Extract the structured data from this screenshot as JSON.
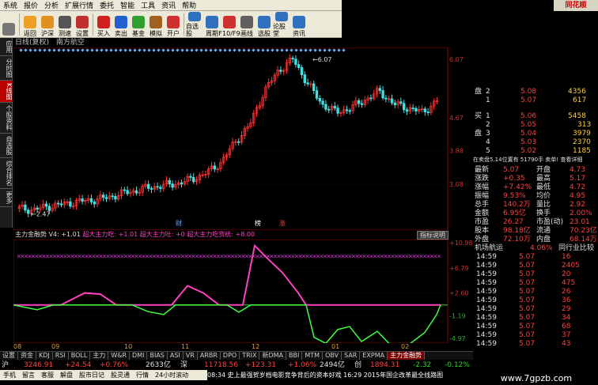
{
  "menu": [
    "系统",
    "报价",
    "分析",
    "扩展行情",
    "委托",
    "智能",
    "工具",
    "资讯",
    "帮助"
  ],
  "brand": "同花顺",
  "toolbar": [
    {
      "label": "",
      "icon": "grid-icon",
      "color": "#777"
    },
    {
      "label": "返回",
      "icon": "back-arrow-icon",
      "color": "#f0a020"
    },
    {
      "label": "沪深",
      "icon": "face-icon",
      "color": "#e09020"
    },
    {
      "label": "测速",
      "icon": "clock-icon",
      "color": "#555"
    },
    {
      "label": "设置",
      "icon": "close-icon",
      "color": "#c03030"
    },
    {
      "label": "买入",
      "icon": "buy-icon",
      "color": "#d02020"
    },
    {
      "label": "卖出",
      "icon": "sell-icon",
      "color": "#2060d0"
    },
    {
      "label": "基金",
      "icon": "fund-icon",
      "color": "#30a030"
    },
    {
      "label": "模拟",
      "icon": "hammer-icon",
      "color": "#a06020"
    },
    {
      "label": "开户",
      "icon": "book-icon",
      "color": "#d03030"
    },
    {
      "label": "自选股",
      "icon": "star-icon",
      "color": "#3070c0"
    },
    {
      "label": "周期",
      "icon": "period-icon",
      "color": "#3070c0"
    },
    {
      "label": "F10/F9",
      "icon": "f10-icon",
      "color": "#d03030"
    },
    {
      "label": "画线",
      "icon": "pen-icon",
      "color": "#606060"
    },
    {
      "label": "选股",
      "icon": "select-icon",
      "color": "#3070c0"
    },
    {
      "label": "论股堂",
      "icon": "forum-icon",
      "color": "#3070c0"
    },
    {
      "label": "资讯",
      "icon": "news-icon",
      "color": "#3070c0"
    }
  ],
  "sidetabs": [
    "应用",
    "分时图",
    "K线图",
    "个股资料",
    "自选股",
    "综合排名",
    "更多"
  ],
  "active_sidetab": 2,
  "chart_title": [
    "日线(复权)",
    "南方航空"
  ],
  "price_axis": [
    "6.07",
    "4.67",
    "3.88",
    "3.08"
  ],
  "peak_label": "6.07",
  "low_label": "2.47",
  "event_markers": [
    "财",
    "榜",
    "涨"
  ],
  "indicator": {
    "name": "主力金融势",
    "v4": "V4: +1.01",
    "a": "超大主力吃: +1.01",
    "b": "超大主力吐: +0",
    "c": "超大主力吃货统: +8.00",
    "help": "指标说明",
    "axis": [
      "+10.98",
      "+6.79",
      "+2.60",
      "-1.19",
      "-4.97"
    ]
  },
  "dates": [
    "08",
    "09",
    "10",
    "11",
    "12",
    "01",
    "02"
  ],
  "bottom_tabs": [
    "设置",
    "资金",
    "KDJ",
    "RSI",
    "BOLL",
    "主力",
    "W&R",
    "DMI",
    "BIAS",
    "ASI",
    "VR",
    "ARBR",
    "DPO",
    "TRIX",
    "新DMA",
    "BBI",
    "MTM",
    "OBV",
    "SAR",
    "EXPMA",
    "主力金融势"
  ],
  "active_bottom_tab": "主力金融势",
  "orderbook": {
    "sell_label": "盘",
    "buy_label": "买",
    "pan_label": "盘",
    "sells": [
      [
        "2",
        "5.08",
        "4356"
      ],
      [
        "1",
        "5.07",
        "617"
      ]
    ],
    "buys": [
      [
        "1",
        "5.06",
        "5458"
      ],
      [
        "2",
        "5.05",
        "313"
      ],
      [
        "3",
        "5.04",
        "3979"
      ],
      [
        "4",
        "5.03",
        "2370"
      ],
      [
        "5",
        "5.02",
        "1185"
      ]
    ]
  },
  "note": "在卖盘5.14位置有    51790手 卖单! 查看详细",
  "stats": [
    [
      "最新",
      "5.07",
      "开盘",
      "4.73"
    ],
    [
      "涨跌",
      "+0.35",
      "最高",
      "5.17"
    ],
    [
      "涨幅",
      "+7.42%",
      "最低",
      "4.72"
    ],
    [
      "振幅",
      "9.53%",
      "均价",
      "4.95"
    ],
    [
      "总手",
      "140.2万",
      "量比",
      "2.92"
    ],
    [
      "金额",
      "6.95亿",
      "换手",
      "2.00%"
    ],
    [
      "市盈",
      "26.27",
      "市盈(动)",
      "23.01"
    ],
    [
      "股本",
      "98.18亿",
      "流通",
      "70.23亿"
    ],
    [
      "外盘",
      "72.10万",
      "内盘",
      "68.14万"
    ]
  ],
  "sector": [
    "机场航运",
    "4.06%",
    "同行业比较"
  ],
  "ticks": [
    [
      "14:59",
      "5.07",
      "16"
    ],
    [
      "14:59",
      "5.07",
      "2405"
    ],
    [
      "14:59",
      "5.07",
      "20"
    ],
    [
      "14:59",
      "5.07",
      "475"
    ],
    [
      "14:59",
      "5.07",
      "26"
    ],
    [
      "14:59",
      "5.07",
      "36"
    ],
    [
      "14:59",
      "5.07",
      "29"
    ],
    [
      "14:59",
      "5.07",
      "34"
    ],
    [
      "14:59",
      "5.07",
      "68"
    ],
    [
      "14:59",
      "5.07",
      "37"
    ],
    [
      "14:59",
      "5.07",
      "43"
    ]
  ],
  "status": {
    "market": "沪",
    "index": "3246.91",
    "chg": "+24.54",
    "pct": "+0.76%",
    "vol": "2633亿",
    "sz": "深",
    "sz_index": "11718.56",
    "sz_chg": "+123.31",
    "sz_pct": "+1.06%",
    "sz_vol": "2494亿",
    "cy": "创",
    "cy_index": "1894.31",
    "cy_chg": "-2.32",
    "cy_pct": "-0.12%"
  },
  "status_links": [
    "手机",
    "留言",
    "客服",
    "解盘",
    "股市日记",
    "股灵通",
    "行情",
    "24小时滚动"
  ],
  "news": "08:34 史上最强贺岁档电影竞争背后的资本好戏     16:29 2015年国企改革最全线路图",
  "watermark": "www.7gpzb.com",
  "chart_data": {
    "type": "candlestick",
    "title": "南方航空 日线(复权)",
    "x": [
      "08",
      "09",
      "10",
      "11",
      "12",
      "01",
      "02"
    ],
    "price_ylim": [
      2.4,
      6.2
    ],
    "indicator_ylim": [
      -4.97,
      10.98
    ],
    "indicator_series": [
      {
        "name": "超大主力吃",
        "color": "#ff40c0"
      },
      {
        "name": "超大主力吐",
        "color": "#40ff40"
      }
    ],
    "close": [
      2.5,
      2.47,
      2.55,
      2.6,
      2.66,
      2.7,
      2.75,
      2.85,
      2.92,
      3.0,
      3.05,
      3.1,
      3.2,
      3.35,
      3.6,
      4.1,
      4.5,
      5.3,
      5.8,
      6.07,
      5.5,
      5.0,
      4.8,
      4.9,
      5.1,
      5.3,
      5.0,
      4.9,
      4.8,
      5.07
    ]
  }
}
